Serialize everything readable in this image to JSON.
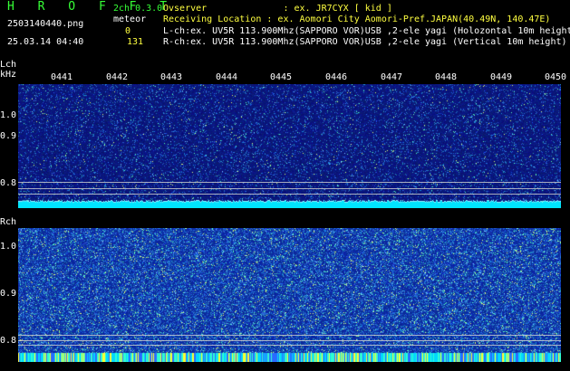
{
  "header": {
    "logo": "H R O F F T",
    "mode": "2ch 0.3.0",
    "file_name": "2503140440.png",
    "meteor_label": "meteor",
    "meteor_count_l": "0",
    "datetime": "25.03.14 04:40",
    "meteor_count_r": "131",
    "observer": "Ovserver              : ex. JR7CYX [ kid ]",
    "location": "Receiving Location : ex. Aomori City Aomori-Pref.JAPAN(40.49N, 140.47E)",
    "lch_info": "L-ch:ex. UV5R 113.900Mhz(SAPPORO VOR)USB ,2-ele yagi (Holozontal 10m height)",
    "rch_info": "R-ch:ex. UV5R 113.900Mhz(SAPPORO VOR)USB ,2-ele yagi (Vertical 10m height)"
  },
  "lch": {
    "label": "Lch",
    "unit": "kHz",
    "y_ticks": [
      "1.0",
      "0.9",
      "0.8"
    ],
    "time_labels": [
      "0441",
      "0442",
      "0443",
      "0444",
      "0445",
      "0446",
      "0447",
      "0448",
      "0449",
      "0450"
    ]
  },
  "rch": {
    "label": "Rch",
    "y_ticks": [
      "1.0",
      "0.9",
      "0.8"
    ]
  },
  "colors": {
    "background": "#000000",
    "header_text": "#36ff36",
    "counter_text": "#ffff40",
    "lch_noise_base": "#0a127a",
    "rch_noise_base": "#06208e",
    "signal_band": "#00e5ff"
  }
}
